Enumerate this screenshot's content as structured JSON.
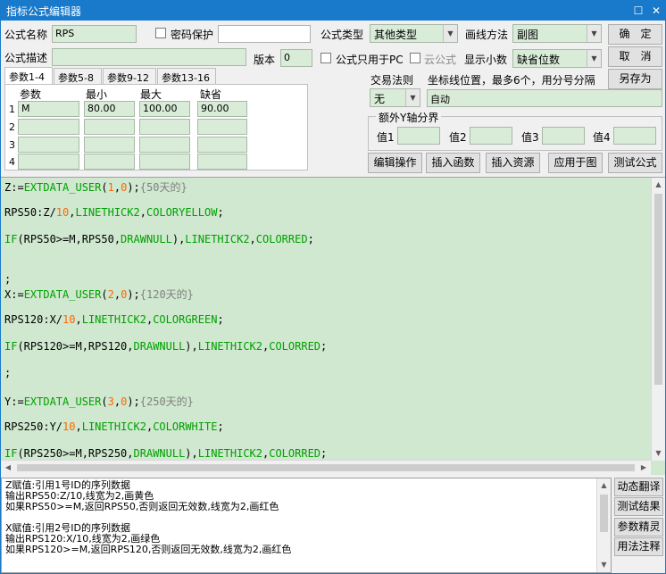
{
  "window": {
    "title": "指标公式编辑器",
    "restore_glyph": "☐",
    "close_glyph": "✕"
  },
  "header": {
    "name_label": "公式名称",
    "name_value": "RPS",
    "password_label": "密码保护",
    "type_label": "公式类型",
    "type_value": "其他类型",
    "draw_label": "画线方法",
    "draw_value": "副图",
    "desc_label": "公式描述",
    "desc_value": "",
    "version_label": "版本",
    "version_value": "0",
    "pc_only_label": "公式只用于PC",
    "cloud_label": "云公式",
    "decimals_label": "显示小数",
    "decimals_value": "缺省位数"
  },
  "buttons": {
    "ok": "确　定",
    "cancel": "取　消",
    "save_as": "另存为",
    "edit_ops": "编辑操作",
    "insert_func": "插入函数",
    "insert_res": "插入资源",
    "apply_chart": "应用于图",
    "test": "测试公式"
  },
  "tabs": [
    "参数1-4",
    "参数5-8",
    "参数9-12",
    "参数13-16"
  ],
  "params": {
    "headers": [
      "参数",
      "最小",
      "最大",
      "缺省"
    ],
    "rows": [
      {
        "num": "1",
        "name": "M",
        "min": "80.00",
        "max": "100.00",
        "def": "90.00"
      },
      {
        "num": "2",
        "name": "",
        "min": "",
        "max": "",
        "def": ""
      },
      {
        "num": "3",
        "name": "",
        "min": "",
        "max": "",
        "def": ""
      },
      {
        "num": "4",
        "name": "",
        "min": "",
        "max": "",
        "def": ""
      }
    ]
  },
  "trade": {
    "rule_label": "交易法则",
    "rule_value": "无",
    "coord_label": "坐标线位置，最多6个，用分号分隔",
    "coord_value": "自动"
  },
  "yaxis": {
    "title": "额外Y轴分界",
    "labels": [
      "值1",
      "值2",
      "值3",
      "值4"
    ]
  },
  "code_lines": [
    [
      [
        "Z:=",
        "#000000"
      ],
      [
        "EXTDATA_USER",
        "#00a000"
      ],
      [
        "(",
        "#000000"
      ],
      [
        "1",
        "#ff6600"
      ],
      [
        ",",
        "#000000"
      ],
      [
        "0",
        "#ff6600"
      ],
      [
        ");",
        "#000000"
      ],
      [
        "{50天的}",
        "#808080"
      ]
    ],
    [
      [
        "RPS50:Z/",
        "#000000"
      ],
      [
        "10",
        "#ff6600"
      ],
      [
        ",",
        "#000000"
      ],
      [
        "LINETHICK2",
        "#00a000"
      ],
      [
        ",",
        "#000000"
      ],
      [
        "COLORYELLOW",
        "#00a000"
      ],
      [
        ";",
        "#000000"
      ]
    ],
    [
      [
        "IF",
        "#00a000"
      ],
      [
        "(RPS50>=M,RPS50,",
        "#000000"
      ],
      [
        "DRAWNULL",
        "#00a000"
      ],
      [
        "),",
        "#000000"
      ],
      [
        "LINETHICK2",
        "#00a000"
      ],
      [
        ",",
        "#000000"
      ],
      [
        "COLORRED",
        "#00a000"
      ],
      [
        ";",
        "#000000"
      ]
    ],
    [
      [
        "",
        "#000000"
      ]
    ],
    [
      [
        ";",
        "#000000"
      ]
    ],
    [
      [
        "X:=",
        "#000000"
      ],
      [
        "EXTDATA_USER",
        "#00a000"
      ],
      [
        "(",
        "#000000"
      ],
      [
        "2",
        "#ff6600"
      ],
      [
        ",",
        "#000000"
      ],
      [
        "0",
        "#ff6600"
      ],
      [
        ");",
        "#000000"
      ],
      [
        "{120天的}",
        "#808080"
      ]
    ],
    [
      [
        "RPS120:X/",
        "#000000"
      ],
      [
        "10",
        "#ff6600"
      ],
      [
        ",",
        "#000000"
      ],
      [
        "LINETHICK2",
        "#00a000"
      ],
      [
        ",",
        "#000000"
      ],
      [
        "COLORGREEN",
        "#00a000"
      ],
      [
        ";",
        "#000000"
      ]
    ],
    [
      [
        "IF",
        "#00a000"
      ],
      [
        "(RPS120>=M,RPS120,",
        "#000000"
      ],
      [
        "DRAWNULL",
        "#00a000"
      ],
      [
        "),",
        "#000000"
      ],
      [
        "LINETHICK2",
        "#00a000"
      ],
      [
        ",",
        "#000000"
      ],
      [
        "COLORRED",
        "#00a000"
      ],
      [
        ";",
        "#000000"
      ]
    ],
    [
      [
        ";",
        "#000000"
      ]
    ],
    [
      [
        "Y:=",
        "#000000"
      ],
      [
        "EXTDATA_USER",
        "#00a000"
      ],
      [
        "(",
        "#000000"
      ],
      [
        "3",
        "#ff6600"
      ],
      [
        ",",
        "#000000"
      ],
      [
        "0",
        "#ff6600"
      ],
      [
        ");",
        "#000000"
      ],
      [
        "{250天的}",
        "#808080"
      ]
    ],
    [
      [
        "RPS250:Y/",
        "#000000"
      ],
      [
        "10",
        "#ff6600"
      ],
      [
        ",",
        "#000000"
      ],
      [
        "LINETHICK2",
        "#00a000"
      ],
      [
        ",",
        "#000000"
      ],
      [
        "COLORWHITE",
        "#00a000"
      ],
      [
        ";",
        "#000000"
      ]
    ],
    [
      [
        "IF",
        "#00a000"
      ],
      [
        "(RPS250>=M,RPS250,",
        "#000000"
      ],
      [
        "DRAWNULL",
        "#00a000"
      ],
      [
        "),",
        "#000000"
      ],
      [
        "LINETHICK2",
        "#00a000"
      ],
      [
        ",",
        "#000000"
      ],
      [
        "COLORRED",
        "#00a000"
      ],
      [
        ";",
        "#000000"
      ]
    ]
  ],
  "notes": [
    "Z赋值:引用1号ID的序列数据",
    "输出RPS50:Z/10,线宽为2,画黄色",
    "如果RPS50>=M,返回RPS50,否则返回无效数,线宽为2,画红色",
    "",
    "X赋值:引用2号ID的序列数据",
    "输出RPS120:X/10,线宽为2,画绿色",
    "如果RPS120>=M,返回RPS120,否则返回无效数,线宽为2,画红色"
  ],
  "side_buttons": [
    "动态翻译",
    "测试结果",
    "参数精灵",
    "用法注释"
  ],
  "colors": {
    "titlebar": "#1979ca",
    "field_bg": "#d8ecd8",
    "editor_bg": "#cfe8cf",
    "keyword": "#00a000",
    "number": "#ff6600",
    "comment": "#808080"
  },
  "icons": {
    "dropdown": "chevron-down-icon",
    "scroll_up": "arrow-up-icon",
    "scroll_down": "arrow-down-icon"
  }
}
